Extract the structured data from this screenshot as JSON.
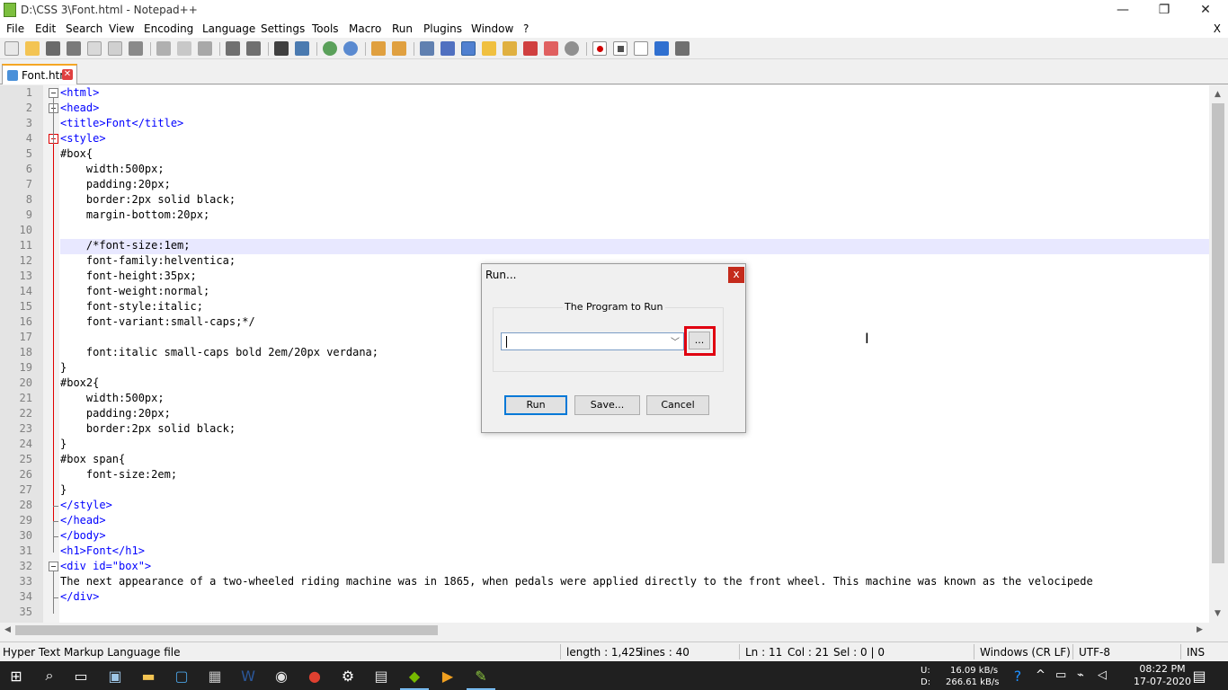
{
  "window": {
    "title": "D:\\CSS 3\\Font.html - Notepad++",
    "minimize": "—",
    "restore": "❐",
    "close": "✕"
  },
  "menu": {
    "items": [
      "File",
      "Edit",
      "Search",
      "View",
      "Encoding",
      "Language",
      "Settings",
      "Tools",
      "Macro",
      "Run",
      "Plugins",
      "Window",
      "?"
    ],
    "close": "X"
  },
  "toolbar": {
    "icons": [
      "new-file-icon",
      "open-file-icon",
      "save-icon",
      "save-all-icon",
      "close-icon",
      "close-all-icon",
      "print-icon",
      "cut-icon",
      "copy-icon",
      "paste-icon",
      "undo-icon",
      "redo-icon",
      "find-icon",
      "replace-icon",
      "zoom-in-icon",
      "zoom-out-icon",
      "sync-vertical-icon",
      "sync-horizontal-icon",
      "word-wrap-icon",
      "show-all-chars-icon",
      "indent-guide-icon",
      "doc-map-icon",
      "function-list-icon",
      "folder-workspace-icon",
      "monitor-icon",
      "record-macro-icon",
      "stop-record-icon",
      "play-macro-icon",
      "run-multiple-icon",
      "save-macro-icon"
    ]
  },
  "tabs": [
    {
      "label": "Font.html"
    }
  ],
  "editor": {
    "lines": [
      {
        "n": "1",
        "t": "<html>"
      },
      {
        "n": "2",
        "t": "<head>"
      },
      {
        "n": "3",
        "t": "<title>Font</title>"
      },
      {
        "n": "4",
        "t": "<style>"
      },
      {
        "n": "5",
        "t": "#box{"
      },
      {
        "n": "6",
        "t": "    width:500px;"
      },
      {
        "n": "7",
        "t": "    padding:20px;"
      },
      {
        "n": "8",
        "t": "    border:2px solid black;"
      },
      {
        "n": "9",
        "t": "    margin-bottom:20px;"
      },
      {
        "n": "10",
        "t": ""
      },
      {
        "n": "11",
        "t": "    /*font-size:1em;"
      },
      {
        "n": "12",
        "t": "    font-family:helventica;"
      },
      {
        "n": "13",
        "t": "    font-height:35px;"
      },
      {
        "n": "14",
        "t": "    font-weight:normal;"
      },
      {
        "n": "15",
        "t": "    font-style:italic;"
      },
      {
        "n": "16",
        "t": "    font-variant:small-caps;*/"
      },
      {
        "n": "17",
        "t": ""
      },
      {
        "n": "18",
        "t": "    font:italic small-caps bold 2em/20px verdana;"
      },
      {
        "n": "19",
        "t": "}"
      },
      {
        "n": "20",
        "t": "#box2{"
      },
      {
        "n": "21",
        "t": "    width:500px;"
      },
      {
        "n": "22",
        "t": "    padding:20px;"
      },
      {
        "n": "23",
        "t": "    border:2px solid black;"
      },
      {
        "n": "24",
        "t": "}"
      },
      {
        "n": "25",
        "t": "#box span{"
      },
      {
        "n": "26",
        "t": "    font-size:2em;"
      },
      {
        "n": "27",
        "t": "}"
      },
      {
        "n": "28",
        "t": "</style>"
      },
      {
        "n": "29",
        "t": "</head>"
      },
      {
        "n": "30",
        "t": "</body>"
      },
      {
        "n": "31",
        "t": "<h1>Font</h1>"
      },
      {
        "n": "32",
        "t": "<div id=\"box\">"
      },
      {
        "n": "33",
        "t": "The next appearance of a two-wheeled riding machine was in 1865, when pedals were applied directly to the front wheel. This machine was known as the velocipede"
      },
      {
        "n": "34",
        "t": "</div>"
      },
      {
        "n": "35",
        "t": ""
      }
    ]
  },
  "run_dialog": {
    "title": "Run...",
    "close": "x",
    "group_label": "The Program to Run",
    "program_value": "",
    "browse_label": "...",
    "run_label": "Run",
    "save_label": "Save...",
    "cancel_label": "Cancel"
  },
  "status": {
    "filetype": "Hyper Text Markup Language file",
    "length": "length : 1,425",
    "lines": "lines : 40",
    "ln": "Ln : 11",
    "col": "Col : 21",
    "sel": "Sel : 0 | 0",
    "eol": "Windows (CR LF)",
    "encoding": "UTF-8",
    "mode": "INS"
  },
  "taskbar": {
    "upload_label": "U:",
    "upload_speed": "16.09 kB/s",
    "download_label": "D:",
    "download_speed": "266.61 kB/s",
    "time": "08:22 PM",
    "date": "17-07-2020"
  }
}
